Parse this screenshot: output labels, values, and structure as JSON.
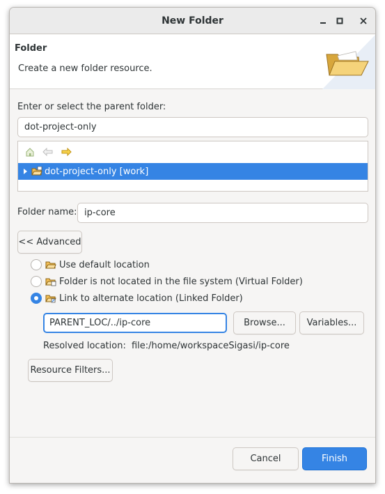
{
  "window": {
    "title": "New Folder",
    "minimize_icon": "minimize-icon",
    "maximize_icon": "maximize-icon",
    "close_icon": "close-icon"
  },
  "banner": {
    "title": "Folder",
    "description": "Create a new folder resource.",
    "icon": "open-folder-icon"
  },
  "parent": {
    "label": "Enter or select the parent folder:",
    "value": "dot-project-only"
  },
  "tree": {
    "toolbar_icons": [
      "home-icon",
      "back-arrow-icon",
      "forward-arrow-icon"
    ],
    "items": [
      {
        "label": "dot-project-only [work]",
        "selected": true,
        "expanded": false
      }
    ]
  },
  "folder_name": {
    "label": "Folder name:",
    "value": "ip-core"
  },
  "advanced_button": "<< Advanced",
  "location_options": [
    {
      "label": "Use default location",
      "checked": false
    },
    {
      "label": "Folder is not located in the file system (Virtual Folder)",
      "checked": false
    },
    {
      "label": "Link to alternate location (Linked Folder)",
      "checked": true
    }
  ],
  "link": {
    "path": "PARENT_LOC/../ip-core",
    "browse_label": "Browse...",
    "variables_label": "Variables...",
    "resolved_label": "Resolved location:",
    "resolved_value": "file:/home/workspaceSigasi/ip-core"
  },
  "resource_filters_label": "Resource Filters...",
  "footer": {
    "cancel_label": "Cancel",
    "finish_label": "Finish"
  },
  "colors": {
    "accent": "#3584e4",
    "selection": "#3584e4",
    "folder": "#f5c056"
  }
}
